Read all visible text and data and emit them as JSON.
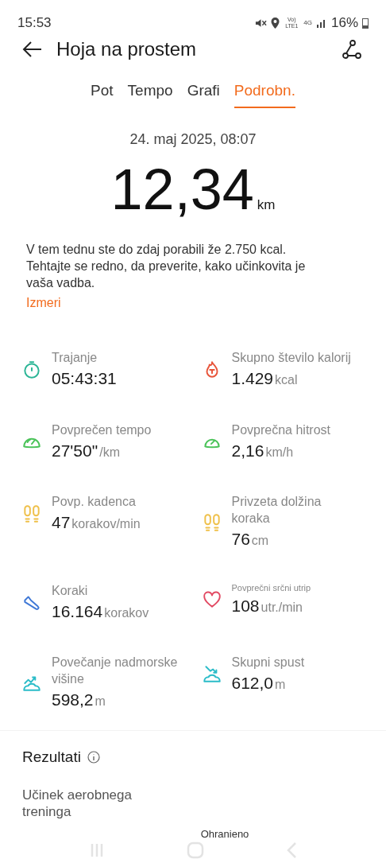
{
  "status_bar": {
    "time": "15:53",
    "network_type": "Vo) LTE1",
    "data_type": "4G",
    "battery": "16%"
  },
  "header": {
    "title": "Hoja na prostem"
  },
  "tabs": [
    {
      "label": "Pot",
      "selected": false
    },
    {
      "label": "Tempo",
      "selected": false
    },
    {
      "label": "Grafi",
      "selected": false
    },
    {
      "label": "Podrobn.",
      "selected": true
    }
  ],
  "summary": {
    "date": "24. maj 2025, 08:07",
    "distance": "12,34",
    "distance_unit": "km",
    "message": "V tem tednu ste do zdaj porabili že 2.750 kcal. Tehtajte se redno, da preverite, kako učinkovita je vaša vadba.",
    "link": "Izmeri"
  },
  "stats": [
    {
      "kind": "timer",
      "color": "#2bb596",
      "label": "Trajanje",
      "value": "05:43:31",
      "compact": false
    },
    {
      "kind": "flame",
      "color": "#e8543a",
      "label": "Skupno število kalorij",
      "value": "1.429",
      "unit": "kcal",
      "compact": false
    },
    {
      "kind": "gauge",
      "color": "#4cc35a",
      "label": "Povprečen tempo",
      "value": "27'50\"",
      "unit": "/km",
      "compact": false
    },
    {
      "kind": "speedometer",
      "color": "#4cc35a",
      "label": "Povprečna hitrost",
      "value": "2,16",
      "unit": "km/h",
      "compact": false
    },
    {
      "kind": "footprints",
      "color": "#efc04a",
      "label": "Povp. kadenca",
      "value": "47",
      "unit": "korakov/min",
      "compact": false
    },
    {
      "kind": "footprints",
      "color": "#efc04a",
      "label": "Privzeta dolžina koraka",
      "value": "76",
      "unit": "cm",
      "compact": false
    },
    {
      "kind": "shoe",
      "color": "#3f78d6",
      "label": "Koraki",
      "value": "16.164",
      "unit": "korakov",
      "compact": false
    },
    {
      "kind": "heart",
      "color": "#e24a63",
      "label": "Povprečni srčni utrip",
      "value": "108",
      "unit": "utr./min",
      "compact": true
    },
    {
      "kind": "ascent",
      "color": "#2bbcc8",
      "label": "Povečanje nadmorske višine",
      "value": "598,2",
      "unit": "m",
      "compact": false
    },
    {
      "kind": "descent",
      "color": "#2bbcc8",
      "label": "Skupni spust",
      "value": "612,0",
      "unit": "m",
      "compact": false
    }
  ],
  "results": {
    "title": "Rezultati",
    "item_label": "Učinek aerobnega treninga",
    "item_value": "Ohranieno"
  }
}
